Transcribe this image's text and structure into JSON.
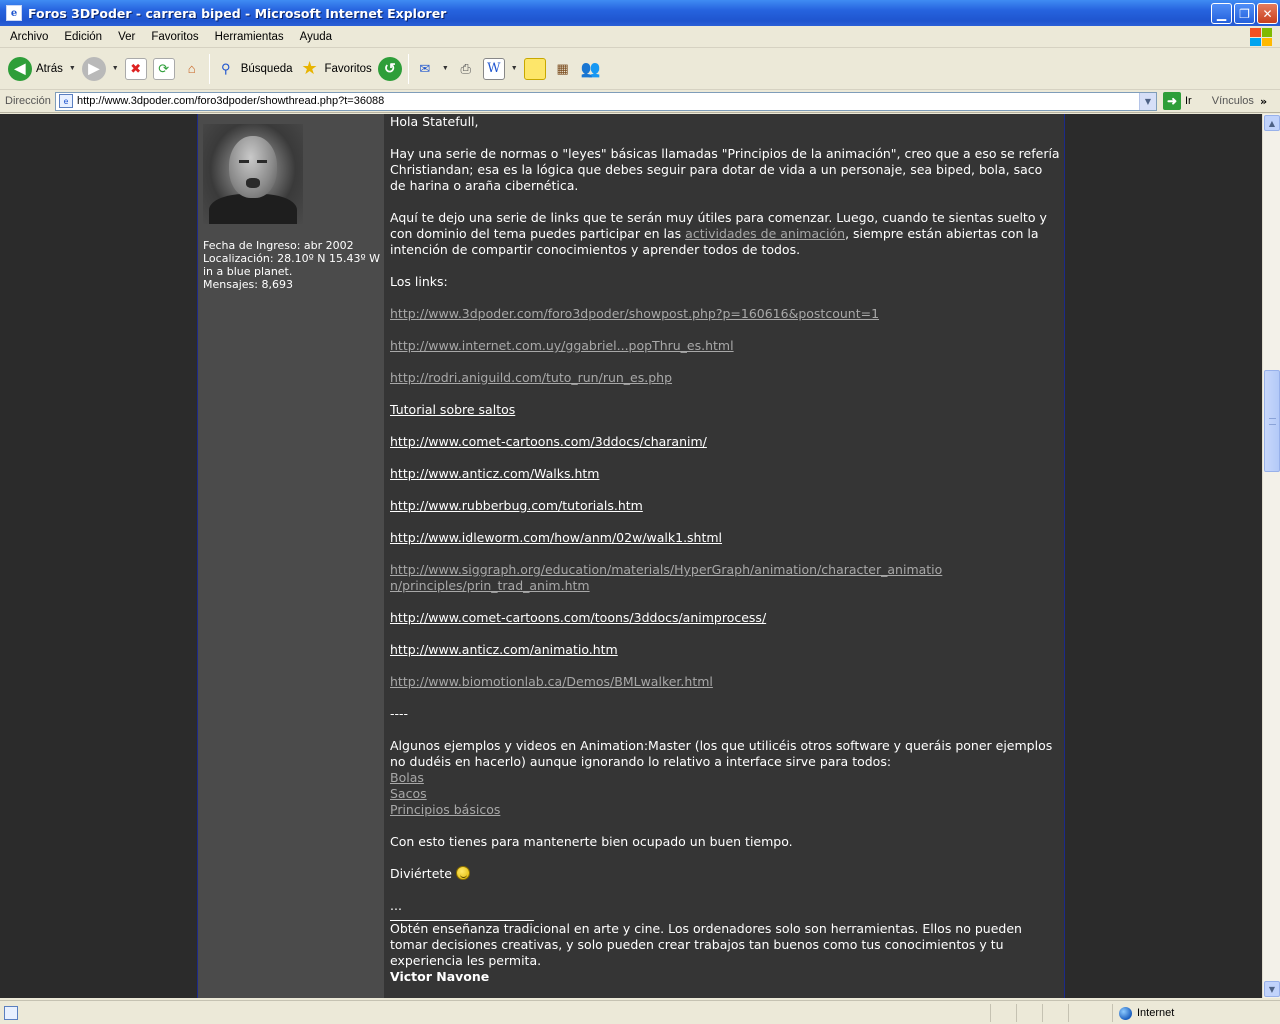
{
  "window": {
    "title": "Foros 3DPoder - carrera biped - Microsoft Internet Explorer",
    "app_icon_glyph": "e"
  },
  "menu": [
    "Archivo",
    "Edición",
    "Ver",
    "Favoritos",
    "Herramientas",
    "Ayuda"
  ],
  "toolbar": {
    "back_label": "Atrás",
    "search_label": "Búsqueda",
    "favorites_label": "Favoritos"
  },
  "address": {
    "label": "Dirección",
    "url": "http://www.3dpoder.com/foro3dpoder/showthread.php?t=36088",
    "go_label": "Ir",
    "links_label": "Vínculos"
  },
  "user": {
    "joined": "Fecha de Ingreso: abr 2002",
    "location": "Localización: 28.10º N 15.43º W in a blue planet.",
    "posts": "Mensajes: 8,693"
  },
  "post": {
    "greeting": "Hola Statefull,",
    "p1": "Hay una serie de normas o \"leyes\" básicas llamadas \"Principios de la animación\", creo que a eso se refería Christiandan; esa es la lógica que debes seguir para dotar de vida a un personaje, sea biped, bola, saco de harina o araña cibernética.",
    "p2_before": "Aquí te dejo una serie de links que te serán muy útiles para comenzar. Luego, cuando te sientas suelto y con dominio del tema puedes participar en las ",
    "p2_link": "actividades de animación",
    "p2_after": ", siempre están abiertas con la intención de compartir conocimientos y aprender todos de todos.",
    "links_heading": "Los links:",
    "links": [
      {
        "text": "http://www.3dpoder.com/foro3dpoder/showpost.php?p=160616&postcount=1",
        "visited": true
      },
      {
        "text": "http://www.internet.com.uy/ggabriel...popThru_es.html",
        "visited": true
      },
      {
        "text": "http://rodri.aniguild.com/tuto_run/run_es.php",
        "visited": true
      },
      {
        "text": "Tutorial sobre saltos",
        "visited": false
      },
      {
        "text": "http://www.comet-cartoons.com/3ddocs/charanim/",
        "visited": false
      },
      {
        "text": "http://www.anticz.com/Walks.htm",
        "visited": false
      },
      {
        "text": "http://www.rubberbug.com/tutorials.htm",
        "visited": false
      },
      {
        "text": "http://www.idleworm.com/how/anm/02w/walk1.shtml",
        "visited": false
      },
      {
        "text": "http://www.siggraph.org/education/materials/HyperGraph/animation/character_animation/principles/prin_trad_anim.htm",
        "visited": true
      },
      {
        "text": "http://www.comet-cartoons.com/toons/3ddocs/animprocess/",
        "visited": false
      },
      {
        "text": "http://www.anticz.com/animatio.htm",
        "visited": false
      },
      {
        "text": "http://www.biomotionlab.ca/Demos/BMLwalker.html",
        "visited": true
      }
    ],
    "divider": "----",
    "examples_text": "Algunos ejemplos y videos en Animation:Master (los que utilicéis otros software y queráis poner ejemplos no dudéis en hacerlo) aunque ignorando lo relativo a interface sirve para todos:",
    "example_links": [
      "Bolas",
      "Sacos",
      "Principios básicos"
    ],
    "closing": "Con esto tienes para mantenerte bien ocupado un buen tiempo.",
    "have_fun": "Diviértete",
    "ellipsis": "...",
    "signature_text": "Obtén enseñanza tradicional en arte y cine. Los ordenadores solo son herramientas. Ellos no pueden tomar decisiones creativas, y solo pueden crear trabajos tan buenos como tus conocimientos y tu experiencia les permita.",
    "signature_name": "Victor Navone"
  },
  "status": {
    "zone": "Internet"
  },
  "colors": {
    "titlebar": "#2663de",
    "page_bg": "#2b2b2b",
    "sidebar_bg": "#4b4b4b",
    "post_bg": "#353535",
    "visited_link": "#a8a8a8"
  }
}
